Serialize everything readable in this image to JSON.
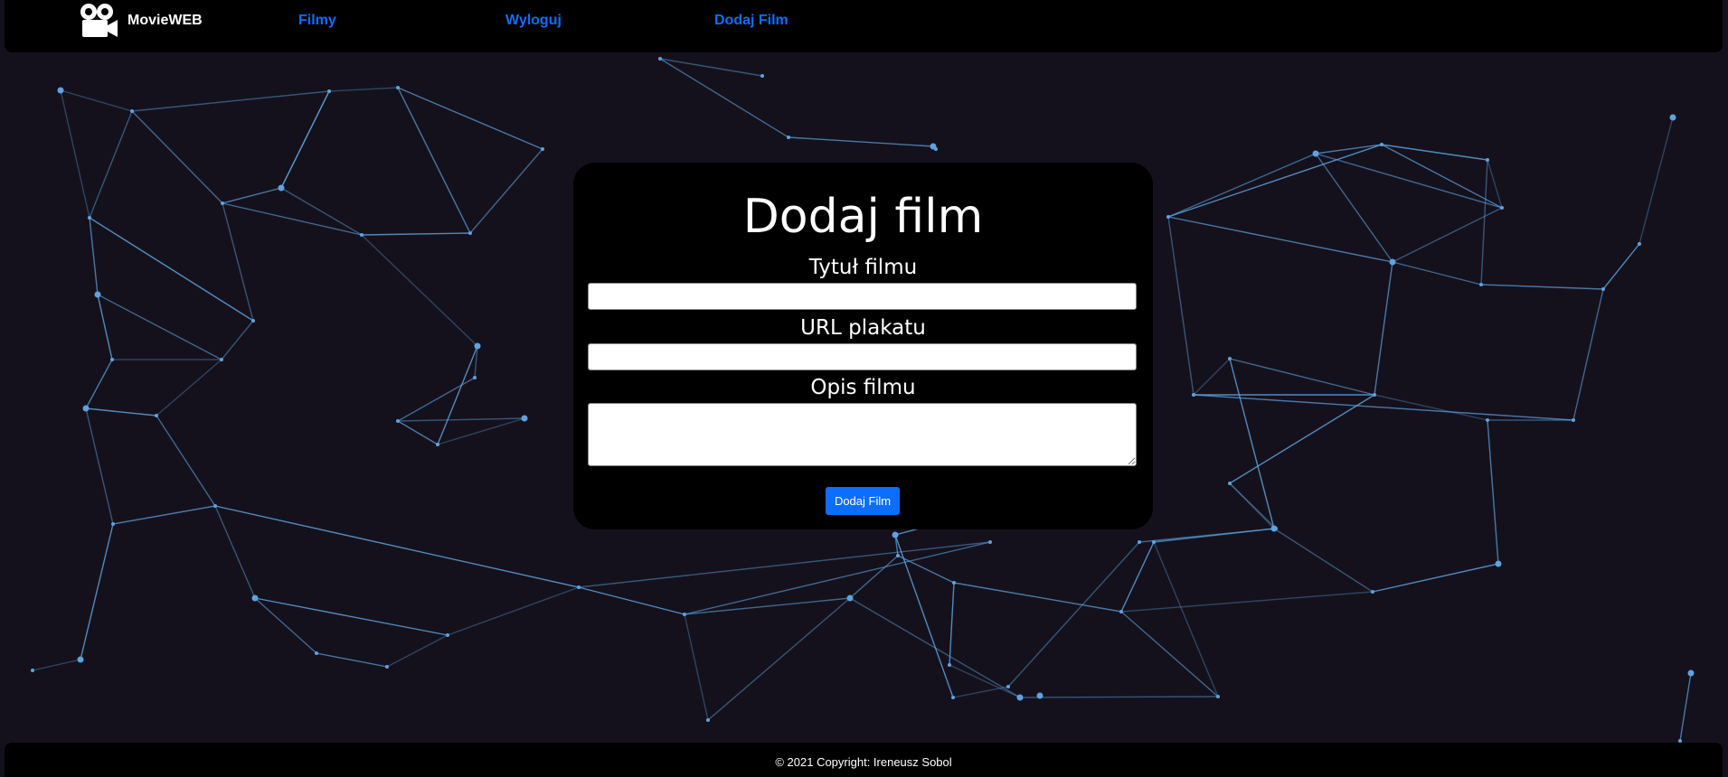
{
  "navbar": {
    "brand": "MovieWEB",
    "logo_icon": "movie-camera-icon",
    "links": [
      "Filmy",
      "Wyloguj",
      "Dodaj Film"
    ],
    "link_color": "#0d6efd"
  },
  "form": {
    "title": "Dodaj film",
    "fields": [
      {
        "label": "Tytuł filmu",
        "value": "",
        "placeholder": ""
      },
      {
        "label": "URL plakatu",
        "value": "",
        "placeholder": ""
      },
      {
        "label": "Opis filmu",
        "value": "",
        "placeholder": ""
      }
    ],
    "submit_label": "Dodaj Film",
    "submit_color": "#0d6efd"
  },
  "footer": {
    "text": "© 2021 Copyright:  Ireneusz Sobol"
  },
  "background": {
    "color": "#15111c",
    "line_color": "#5da3e0"
  }
}
